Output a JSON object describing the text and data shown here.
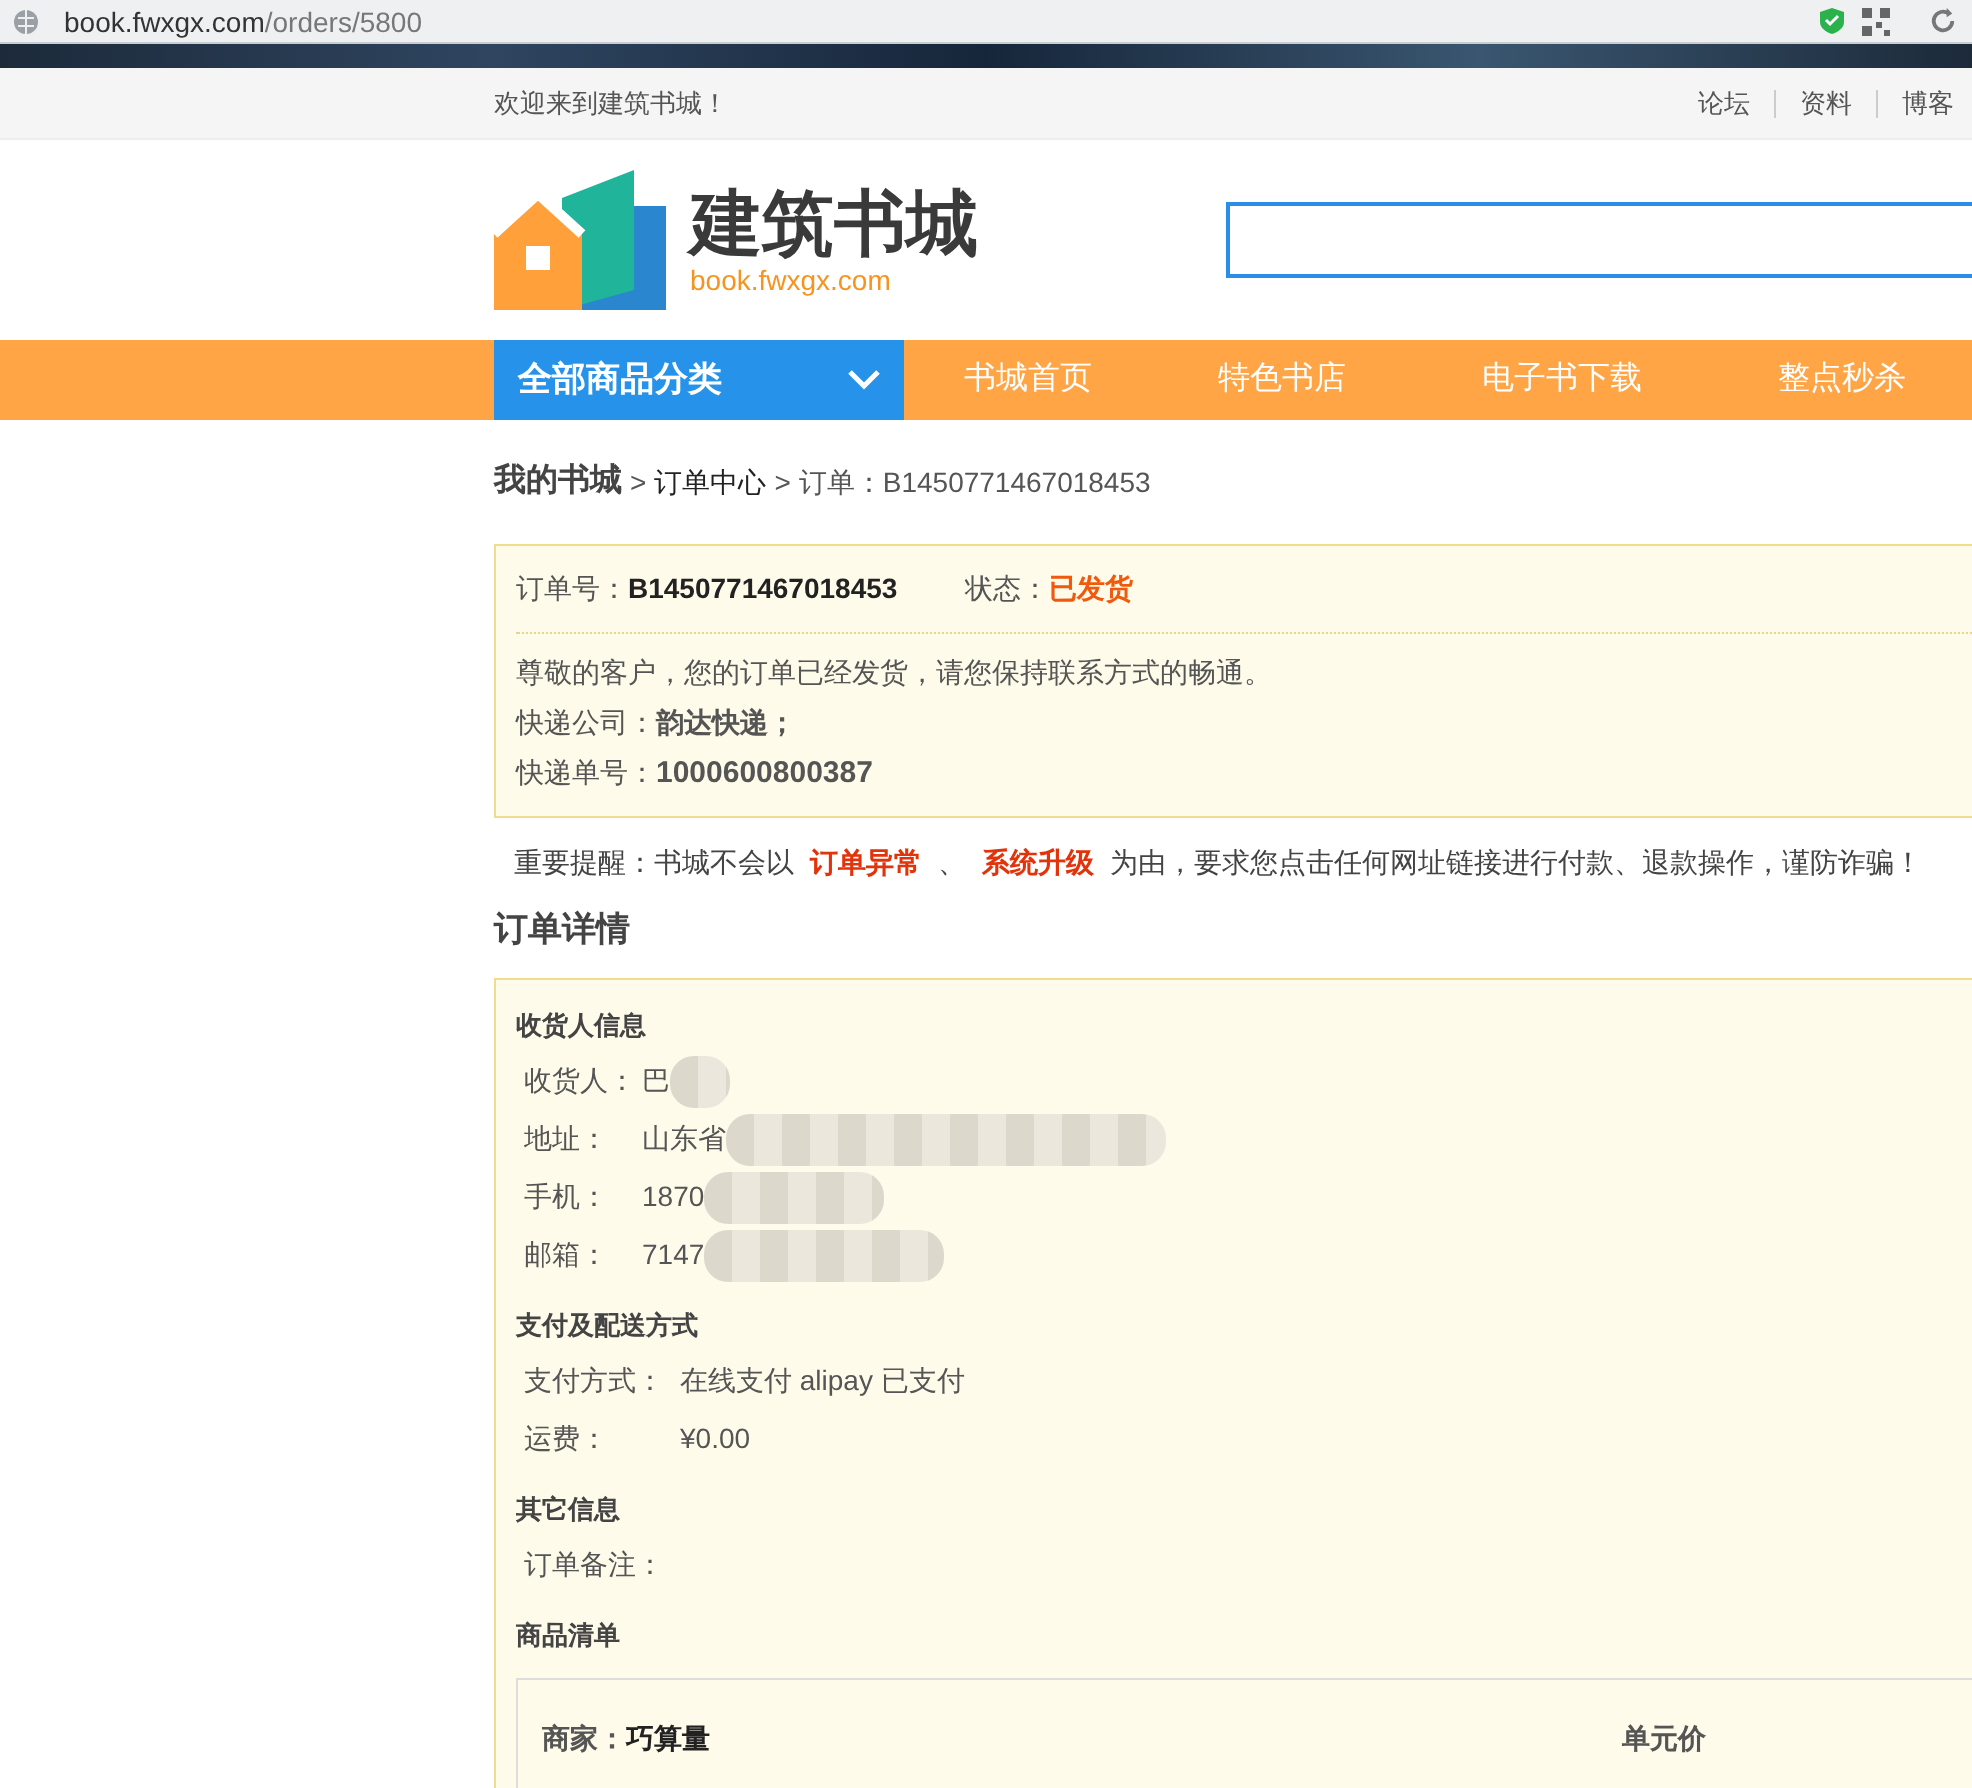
{
  "browser": {
    "url_host": "book.fwxgx.com",
    "url_path": "/orders/5800"
  },
  "topbar": {
    "welcome": "欢迎来到建筑书城！",
    "links": [
      "论坛",
      "资料",
      "博客"
    ]
  },
  "header": {
    "logo_title": "建筑书城",
    "logo_url": "book.fwxgx.com"
  },
  "nav": {
    "category": "全部商品分类",
    "items": [
      "书城首页",
      "特色书店",
      "电子书下载",
      "整点秒杀"
    ]
  },
  "breadcrumb": {
    "separator": ">",
    "items": [
      "我的书城",
      "订单中心",
      "订单：B1450771467018453"
    ]
  },
  "order_summary": {
    "order_no_label": "订单号：",
    "order_no": "B1450771467018453",
    "status_label": "状态：",
    "status": "已发货",
    "message": "尊敬的客户，您的订单已经发货，请您保持联系方式的畅通。",
    "courier_label": "快递公司：",
    "courier": "韵达快递；",
    "tracking_label": "快递单号：",
    "tracking": "1000600800387"
  },
  "notice": [
    {
      "kind": "plain",
      "text": "重要提醒：书城不会以"
    },
    {
      "kind": "highlight",
      "text": "订单异常"
    },
    {
      "kind": "plain",
      "text": "、"
    },
    {
      "kind": "highlight",
      "text": "系统升级"
    },
    {
      "kind": "plain",
      "text": "为由，要求您点击任何网址链接进行付款、退款操作，谨防诈骗！"
    }
  ],
  "details_title": "订单详情",
  "sections": [
    {
      "title": "收货人信息",
      "rows": [
        {
          "label": "收货人：",
          "value": "巴",
          "redacted": true
        },
        {
          "label": "地址：",
          "value": "山东省",
          "redacted": true
        },
        {
          "label": "手机：",
          "value": "1870",
          "redacted": true
        },
        {
          "label": "邮箱：",
          "value": "7147",
          "redacted": true
        }
      ]
    },
    {
      "title": "支付及配送方式",
      "rows": [
        {
          "label": "支付方式：",
          "value": "在线支付 alipay 已支付"
        },
        {
          "label": "运费：",
          "value": "¥0.00"
        }
      ]
    },
    {
      "title": "其它信息",
      "rows": [
        {
          "label": "订单备注："
        }
      ]
    },
    {
      "title": "商品清单"
    }
  ],
  "merchant": {
    "label": "商家：",
    "name": "巧算量",
    "column": "单元价"
  }
}
